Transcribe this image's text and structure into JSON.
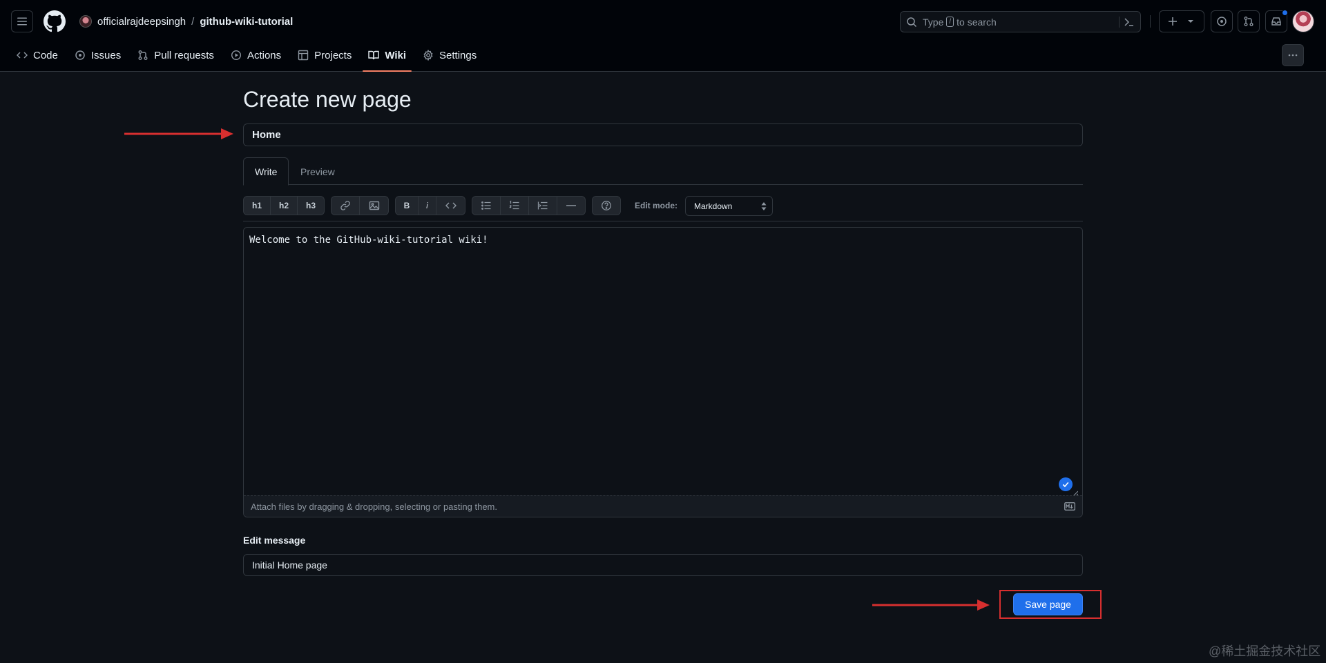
{
  "header": {
    "owner": "officialrajdeepsingh",
    "separator": "/",
    "repo": "github-wiki-tutorial",
    "search": {
      "prefix": "Type",
      "slash_key": "/",
      "suffix": "to search"
    }
  },
  "repo_nav": {
    "items": [
      {
        "label": "Code",
        "icon": "code-icon"
      },
      {
        "label": "Issues",
        "icon": "issue-icon"
      },
      {
        "label": "Pull requests",
        "icon": "pull-request-icon"
      },
      {
        "label": "Actions",
        "icon": "play-icon"
      },
      {
        "label": "Projects",
        "icon": "table-icon"
      },
      {
        "label": "Wiki",
        "icon": "book-icon",
        "active": true
      },
      {
        "label": "Settings",
        "icon": "gear-icon"
      }
    ]
  },
  "page": {
    "title": "Create new page",
    "page_title_value": "Home",
    "tabs": {
      "write": "Write",
      "preview": "Preview"
    },
    "toolbar": {
      "h1": "h1",
      "h2": "h2",
      "h3": "h3",
      "bold": "B",
      "italic": "i"
    },
    "edit_mode_label": "Edit mode:",
    "edit_mode_value": "Markdown",
    "body": "Welcome to the GitHub-wiki-tutorial wiki!",
    "attach_hint": "Attach files by dragging & dropping, selecting or pasting them.",
    "edit_message_label": "Edit message",
    "edit_message_value": "Initial Home page",
    "save_label": "Save page"
  },
  "watermark": "@稀土掘金技术社区",
  "colors": {
    "accent": "#1f6feb",
    "nav_underline": "#f78166",
    "annotation": "#d72f2f"
  }
}
